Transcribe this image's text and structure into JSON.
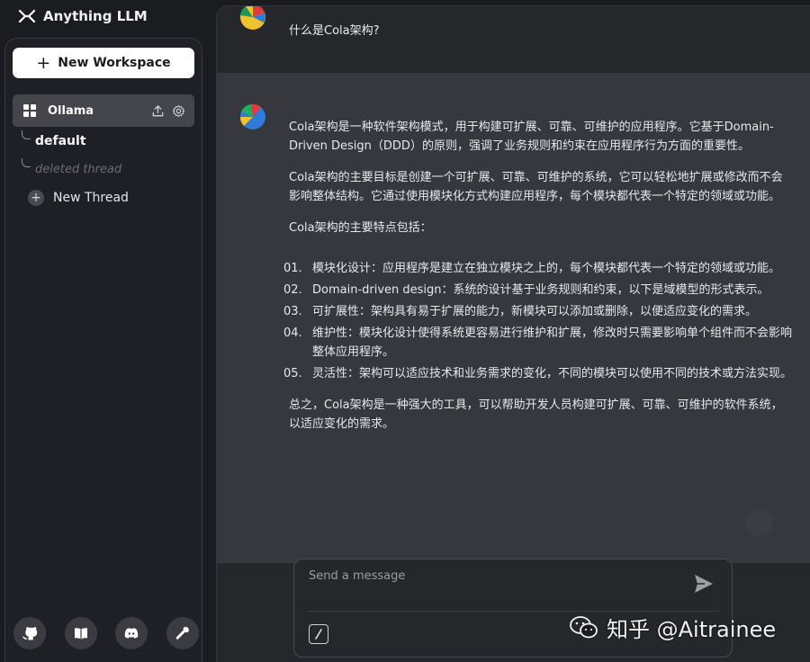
{
  "brand": {
    "name": "Anything LLM"
  },
  "sidebar": {
    "new_workspace_label": "New Workspace",
    "workspace": {
      "name": "Ollama"
    },
    "threads": [
      {
        "label": "default",
        "state": "active"
      },
      {
        "label": "deleted thread",
        "state": "deleted"
      }
    ],
    "new_thread_label": "New Thread",
    "footer_icons": [
      "github-icon",
      "book-icon",
      "discord-icon",
      "wrench-icon"
    ]
  },
  "chat": {
    "user_message": "什么是Cola架构?",
    "assistant": {
      "paragraphs": [
        "Cola架构是一种软件架构模式，用于构建可扩展、可靠、可维护的应用程序。它基于Domain-Driven Design（DDD）的原则，强调了业务规则和约束在应用程序行为方面的重要性。",
        "Cola架构的主要目标是创建一个可扩展、可靠、可维护的系统，它可以轻松地扩展或修改而不会影响整体结构。它通过使用模块化方式构建应用程序，每个模块都代表一个特定的领域或功能。",
        "Cola架构的主要特点包括："
      ],
      "list": [
        {
          "num": "01.",
          "text": "模块化设计：应用程序是建立在独立模块之上的，每个模块都代表一个特定的领域或功能。"
        },
        {
          "num": "02.",
          "text": "Domain-driven design：系统的设计基于业务规则和约束，以下是域模型的形式表示。"
        },
        {
          "num": "03.",
          "text": "可扩展性：架构具有易于扩展的能力，新模块可以添加或删除，以便适应变化的需求。"
        },
        {
          "num": "04.",
          "text": "维护性：模块化设计使得系统更容易进行维护和扩展，修改时只需要影响单个组件而不会影响整体应用程序。"
        },
        {
          "num": "05.",
          "text": "灵活性：架构可以适应技术和业务需求的变化，不同的模块可以使用不同的技术或方法实现。"
        }
      ],
      "conclusion": "总之，Cola架构是一种强大的工具，可以帮助开发人员构建可扩展、可靠、可维护的软件系统，以适应变化的需求。"
    }
  },
  "composer": {
    "placeholder": "Send a message"
  },
  "watermark": {
    "text": "知乎 @Aitrainee"
  },
  "colors": {
    "background": "#1b1c20",
    "main": "#26272b",
    "assistant_row": "#37383d",
    "workspace_active": "#45464c"
  }
}
